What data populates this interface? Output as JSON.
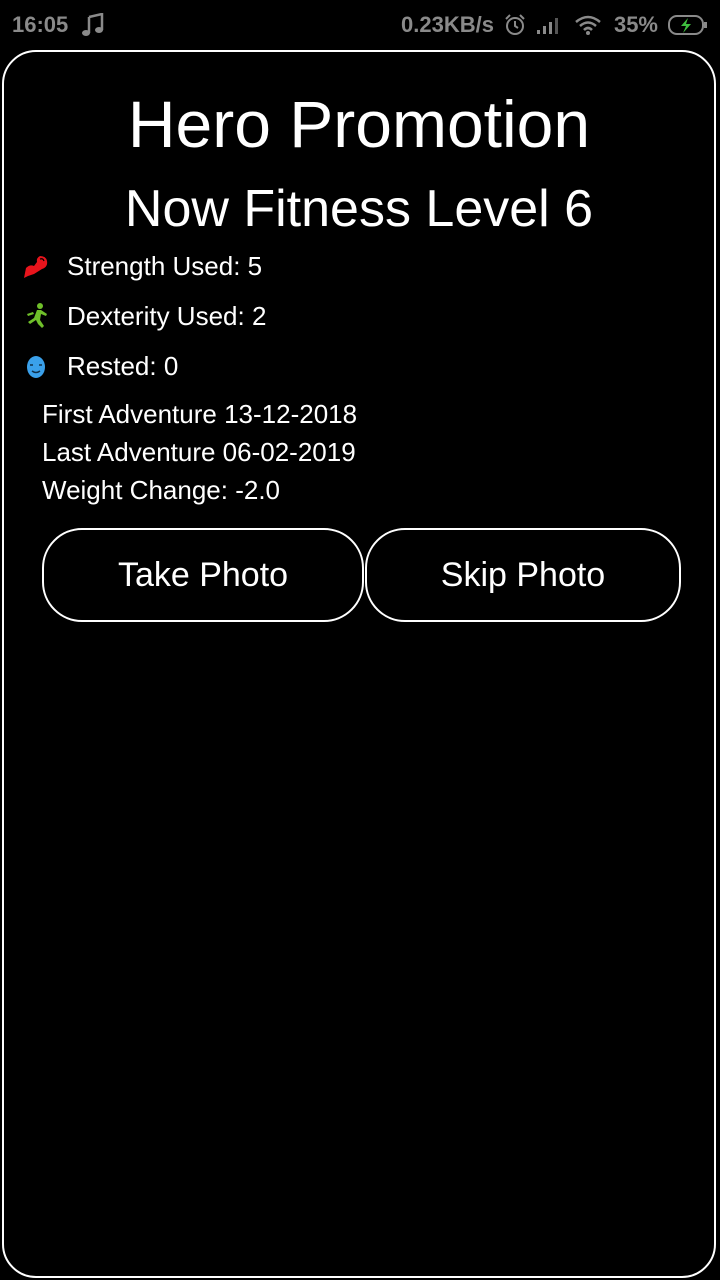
{
  "status_bar": {
    "time": "16:05",
    "network_speed": "0.23KB/s",
    "battery_percent": "35%",
    "icons": [
      "music-note-icon",
      "alarm-icon",
      "signal-icon",
      "wifi-icon",
      "battery-charging-icon"
    ]
  },
  "header": {
    "title": "Hero Promotion",
    "subtitle": "Now Fitness Level 6"
  },
  "stats": [
    {
      "icon": "flexed-arm-icon",
      "label": "Strength Used: 5",
      "color": "#e8141c"
    },
    {
      "icon": "runner-icon",
      "label": "Dexterity Used: 2",
      "color": "#6fbf2a"
    },
    {
      "icon": "rest-face-icon",
      "label": "Rested: 0",
      "color": "#3aa0ea"
    }
  ],
  "info": {
    "first_adventure": "First Adventure 13-12-2018",
    "last_adventure": "Last Adventure 06-02-2019",
    "weight_change": "Weight Change: -2.0"
  },
  "actions": {
    "take_photo": "Take Photo",
    "skip_photo": "Skip Photo"
  }
}
